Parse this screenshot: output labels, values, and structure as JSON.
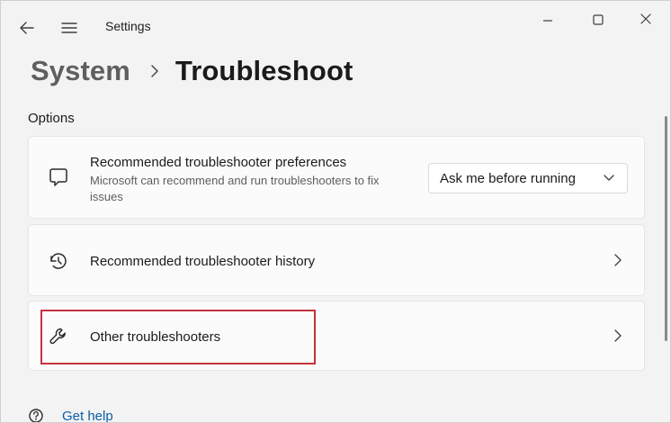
{
  "window": {
    "app_title": "Settings",
    "controls": {
      "minimize_icon": "minimize-icon",
      "maximize_icon": "maximize-icon",
      "close_icon": "close-icon"
    }
  },
  "header": {
    "back_icon": "back-arrow-icon",
    "menu_icon": "hamburger-menu-icon",
    "breadcrumb": {
      "parent": "System",
      "separator_icon": "chevron-right-icon",
      "current": "Troubleshoot"
    }
  },
  "main": {
    "section_title": "Options",
    "cards": [
      {
        "icon": "message-icon",
        "title": "Recommended troubleshooter preferences",
        "description": "Microsoft can recommend and run troubleshooters to fix issues",
        "control": {
          "type": "dropdown",
          "selected_value": "Ask me before running",
          "icon": "chevron-down-icon"
        }
      },
      {
        "icon": "history-icon",
        "title": "Recommended troubleshooter history",
        "action_icon": "chevron-right-icon"
      },
      {
        "icon": "wrench-icon",
        "title": "Other troubleshooters",
        "action_icon": "chevron-right-icon",
        "highlighted": true
      }
    ]
  },
  "footer": {
    "help_icon": "help-icon",
    "help_label": "Get help"
  },
  "colors": {
    "background": "#f3f3f3",
    "card": "#fbfbfb",
    "highlight_border": "#c4333f",
    "link": "#0f5da8"
  }
}
